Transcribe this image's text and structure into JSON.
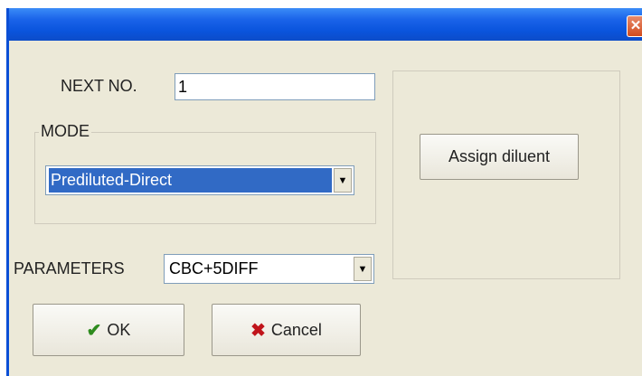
{
  "window": {
    "title": "",
    "close_glyph": "✕"
  },
  "next_no": {
    "label": "NEXT NO.",
    "value": "1"
  },
  "mode": {
    "group_label": "MODE",
    "selected": "Prediluted-Direct"
  },
  "parameters": {
    "label": "PARAMETERS",
    "selected": "CBC+5DIFF"
  },
  "buttons": {
    "assign_diluent": "Assign diluent",
    "ok": "OK",
    "ok_icon": "check-icon",
    "cancel": "Cancel",
    "cancel_icon": "x-icon"
  },
  "colors": {
    "title_bar": "#0a54dd",
    "selection": "#316ac5",
    "ok_check": "#2e8b1e",
    "cancel_x": "#c0141b"
  }
}
